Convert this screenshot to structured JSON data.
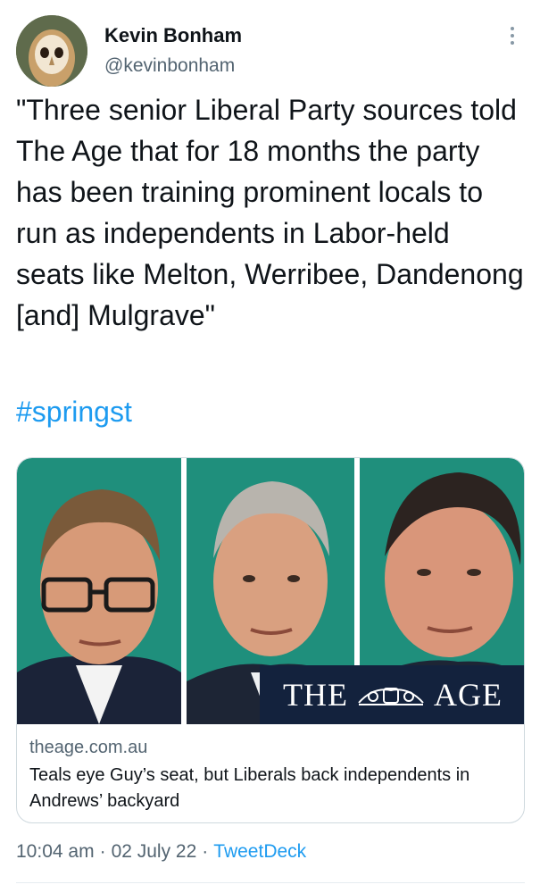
{
  "author": {
    "display_name": "Kevin Bonham",
    "handle": "@kevinbonham",
    "avatar_icon": "owl-avatar-icon"
  },
  "tweet": {
    "text": "\"Three senior Liberal Party sources told The Age that for 18 months the party has been training prominent locals to run as independents in Labor-held seats like Melton, Werribee, Dandenong [and] Mulgrave\"",
    "hashtag": "#springst"
  },
  "card": {
    "logo": {
      "left": "THE",
      "right": "AGE"
    },
    "domain": "theage.com.au",
    "title": "Teals eye Guy’s seat, but Liberals back independents in Andrews’ backyard"
  },
  "meta": {
    "time": "10:04 am",
    "separator1": "·",
    "date": "02 July 22",
    "separator2": "·",
    "source": "TweetDeck"
  },
  "colors": {
    "accent": "#1d9bf0",
    "muted": "#536471",
    "logo_bar": "#13223d",
    "photo_bg": "#1f8f7c"
  }
}
